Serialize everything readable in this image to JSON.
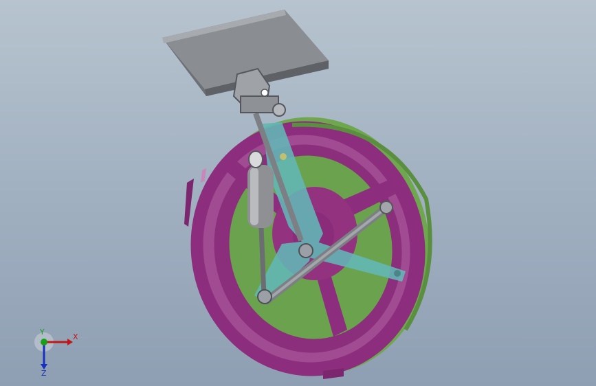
{
  "app": {
    "title": ""
  },
  "model": {
    "name": ""
  },
  "triad": {
    "x_label": "X",
    "y_label": "Y",
    "z_label": "Z",
    "x_color": "#c01818",
    "y_color": "#18a018",
    "z_color": "#1830c0"
  },
  "colors": {
    "plate": "#8a8d92",
    "wheel_rim": "#8d2d7d",
    "wheel_fill": "#6aa24d",
    "arm": "#63b8b7",
    "shock": "#8e9094"
  }
}
